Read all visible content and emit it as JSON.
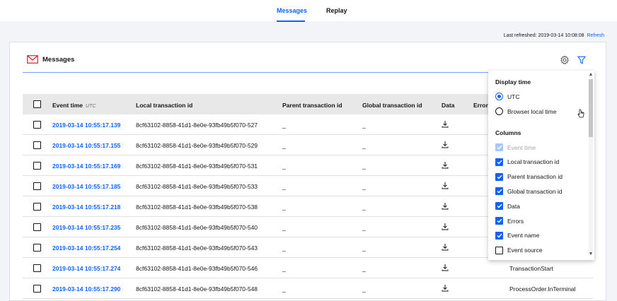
{
  "tabs": [
    {
      "label": "Messages",
      "active": true
    },
    {
      "label": "Replay",
      "active": false
    }
  ],
  "refresh": {
    "label": "Last refreshed: 2019-03-14 10:08:08",
    "link": "Refresh"
  },
  "card": {
    "title": "Messages",
    "icons": [
      "mail-icon",
      "settings-icon",
      "filter-icon"
    ]
  },
  "table": {
    "columns": {
      "event_time": "Event time",
      "event_time_tz": "UTC",
      "local_id": "Local transaction id",
      "parent_id": "Parent transaction id",
      "global_id": "Global transaction id",
      "data": "Data",
      "errors": "Error"
    },
    "rows": [
      {
        "time": "2019-03-14 10:55:17.139",
        "local": "8cf63102-8858-41d1-8e0e-93fb49b5f070-527",
        "parent": "_",
        "global": "_",
        "event": ""
      },
      {
        "time": "2019-03-14 10:55:17.155",
        "local": "8cf63102-8858-41d1-8e0e-93fb49b5f070-529",
        "parent": "_",
        "global": "_",
        "event": ""
      },
      {
        "time": "2019-03-14 10:55:17.169",
        "local": "8cf63102-8858-41d1-8e0e-93fb49b5f070-531",
        "parent": "_",
        "global": "_",
        "event": ""
      },
      {
        "time": "2019-03-14 10:55:17.185",
        "local": "8cf63102-8858-41d1-8e0e-93fb49b5f070-533",
        "parent": "_",
        "global": "_",
        "event": ""
      },
      {
        "time": "2019-03-14 10:55:17.218",
        "local": "8cf63102-8858-41d1-8e0e-93fb49b5f070-538",
        "parent": "_",
        "global": "_",
        "event": ""
      },
      {
        "time": "2019-03-14 10:55:17.235",
        "local": "8cf63102-8858-41d1-8e0e-93fb49b5f070-540",
        "parent": "_",
        "global": "_",
        "event": ""
      },
      {
        "time": "2019-03-14 10:55:17.254",
        "local": "8cf63102-8858-41d1-8e0e-93fb49b5f070-543",
        "parent": "_",
        "global": "_",
        "event": ""
      },
      {
        "time": "2019-03-14 10:55:17.274",
        "local": "8cf63102-8858-41d1-8e0e-93fb49b5f070-546",
        "parent": "_",
        "global": "_",
        "event": "TransactionStart"
      },
      {
        "time": "2019-03-14 10:55:17.290",
        "local": "8cf63102-8858-41d1-8e0e-93fb49b5f070-548",
        "parent": "_",
        "global": "_",
        "event": "ProcessOrder.InTerminal"
      }
    ]
  },
  "settings_panel": {
    "display_time_heading": "Display time",
    "display_time_options": [
      {
        "label": "UTC",
        "selected": true
      },
      {
        "label": "Browser local time",
        "selected": false
      }
    ],
    "columns_heading": "Columns",
    "columns": [
      {
        "label": "Event time",
        "checked": true,
        "disabled": true
      },
      {
        "label": "Local transaction id",
        "checked": true,
        "disabled": false
      },
      {
        "label": "Parent transaction id",
        "checked": true,
        "disabled": false
      },
      {
        "label": "Global transaction id",
        "checked": true,
        "disabled": false
      },
      {
        "label": "Data",
        "checked": true,
        "disabled": false
      },
      {
        "label": "Errors",
        "checked": true,
        "disabled": false
      },
      {
        "label": "Event name",
        "checked": true,
        "disabled": false
      },
      {
        "label": "Event source",
        "checked": false,
        "disabled": false
      }
    ]
  },
  "colors": {
    "accent": "#0f62fe",
    "background": "#f2f4f8",
    "header_row": "#e8e8e8"
  }
}
